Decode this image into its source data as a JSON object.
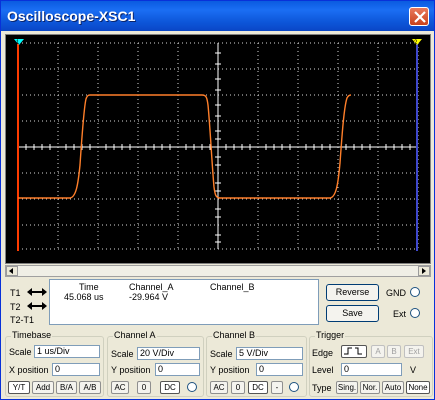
{
  "window": {
    "title": "Oscilloscope-XSC1"
  },
  "readout": {
    "headers": {
      "time": "Time",
      "channel_a": "Channel_A",
      "channel_b": "Channel_B"
    },
    "cursor_labels": [
      "T1",
      "T2",
      "T2-T1"
    ],
    "t1": {
      "time": "45.068 us",
      "channel_a": "-29.964 V",
      "channel_b": ""
    }
  },
  "buttons": {
    "reverse": "Reverse",
    "save": "Save"
  },
  "options": {
    "gnd": "GND",
    "ext": "Ext"
  },
  "timebase": {
    "title": "Timebase",
    "scale_label": "Scale",
    "scale_value": "1 us/Div",
    "xpos_label": "X position",
    "xpos_value": "0",
    "modes": [
      "Y/T",
      "Add",
      "B/A",
      "A/B"
    ]
  },
  "channel_a": {
    "title": "Channel A",
    "scale_label": "Scale",
    "scale_value": "20  V/Div",
    "ypos_label": "Y position",
    "ypos_value": "0",
    "coupling": [
      "AC",
      "0",
      "DC"
    ]
  },
  "channel_b": {
    "title": "Channel B",
    "scale_label": "Scale",
    "scale_value": "5  V/Div",
    "ypos_label": "Y position",
    "ypos_value": "0",
    "coupling": [
      "AC",
      "0",
      "DC",
      "-"
    ]
  },
  "trigger": {
    "title": "Trigger",
    "edge_label": "Edge",
    "edge_buttons": [
      "A",
      "B",
      "Ext"
    ],
    "level_label": "Level",
    "level_value": "0",
    "level_unit": "V",
    "type_label": "Type",
    "type_buttons": [
      "Sing.",
      "Nor.",
      "Auto",
      "None"
    ]
  },
  "colors": {
    "trace": "#ff7f2a",
    "cursor_t1": "#ff3c00",
    "cursor_t2": "#3f48cc",
    "grid": "#ffffff",
    "marker": "#00ffff",
    "marker2": "#ffff00"
  },
  "icons": {
    "close": "close-icon",
    "t1_arrows": "arrow-left-right-icon",
    "t2_arrows": "arrow-left-right-icon",
    "edge": "rising-edge-icon"
  }
}
